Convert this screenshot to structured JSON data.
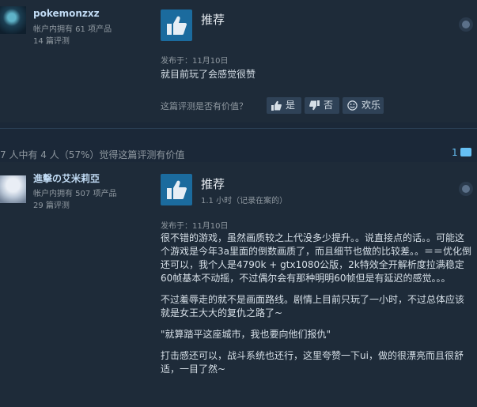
{
  "reviews": [
    {
      "username": "pokemonzxz",
      "products_owned": "帐户内拥有 61 项产品",
      "review_count": "14 篇评测",
      "verdict": "推荐",
      "posted": "发布于：11月10日",
      "paragraphs": [
        "就目前玩了会感觉很赞"
      ],
      "vote_question": "这篇评测是否有价值？",
      "vote_yes": "是",
      "vote_no": "否",
      "vote_funny": "欢乐"
    },
    {
      "username": "進擊の艾米莉亞",
      "products_owned": "帐户内拥有 507 项产品",
      "review_count": "29 篇评测",
      "verdict": "推荐",
      "hours": "1.1 小时（记录在案的）",
      "posted": "发布于：11月10日",
      "paragraphs": [
        "很不错的游戏，虽然画质较之上代没多少提升。。说直接点的话。。可能这个游戏是今年3a里面的倒数画质了，而且细节也做的比较差。。＝＝优化倒还可以，我个人是4790k + gtx1080公版，2k特效全开解析度拉满稳定60帧基本不动摇，不过偶尔会有那种明明60帧但是有延迟的感觉。。。",
        "不过羞辱走的就不是画面路线。剧情上目前只玩了一小时，不过总体应该就是女王大大的复仇之路了~",
        "\"就算踏平这座城市，我也要向他们报仇\"",
        "打击感还可以，战斗系统也还行，这里夸赞一下ui，做的很漂亮而且很舒适，一目了然~"
      ]
    }
  ],
  "helpful_summary": "7 人中有 4 人（57%）觉得这篇评测有价值",
  "comment_count": "1",
  "colors": {
    "background": "#1b2838",
    "thumb_box": "#1b6b9e",
    "link": "#66c0f4"
  }
}
